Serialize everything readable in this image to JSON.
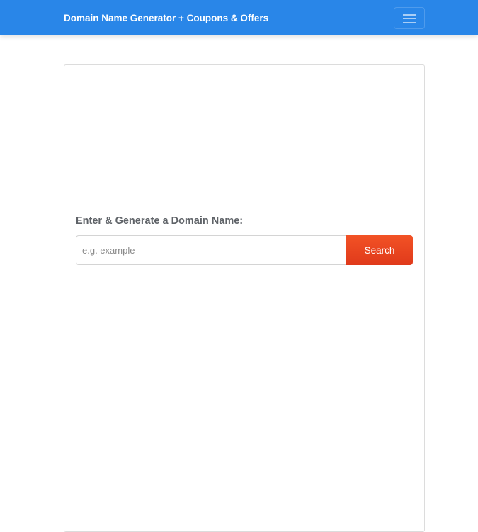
{
  "navbar": {
    "brand": "Domain Name Generator + Coupons & Offers",
    "toggler_icon": "hamburger-menu-icon",
    "background_color": "#2986e8"
  },
  "form": {
    "label": "Enter & Generate a Domain Name:",
    "input_value": "",
    "input_placeholder": "e.g. example",
    "search_label": "Search",
    "search_button_color": "#ef4a22"
  }
}
